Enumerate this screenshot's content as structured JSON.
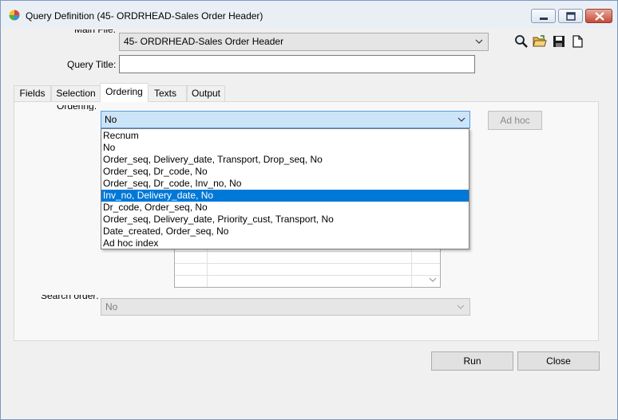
{
  "window": {
    "title": "Query Definition (45- ORDRHEAD-Sales Order Header)",
    "icon": "app-color-wheel-icon",
    "controls": [
      "minimize",
      "maximize",
      "close"
    ]
  },
  "main_file": {
    "label": "Main File:",
    "value": "45- ORDRHEAD-Sales Order Header"
  },
  "query_title": {
    "label": "Query Title:",
    "value": ""
  },
  "toolbar": {
    "icons": [
      "search-icon",
      "open-folder-icon",
      "save-icon",
      "new-document-icon"
    ]
  },
  "tabs": [
    {
      "label": "Fields",
      "active": false
    },
    {
      "label": "Selection",
      "active": false
    },
    {
      "label": "Ordering",
      "active": true
    },
    {
      "label": "Texts",
      "active": false
    },
    {
      "label": "Output",
      "active": false
    }
  ],
  "ordering": {
    "label": "Ordering:",
    "value": "No",
    "adhoc_button": "Ad hoc",
    "options": [
      "Recnum",
      "No",
      "Order_seq, Delivery_date, Transport, Drop_seq, No",
      "Order_seq, Dr_code, No",
      "Order_seq, Dr_code, Inv_no, No",
      "Inv_no, Delivery_date, No",
      "Dr_code, Order_seq, No",
      "Order_seq, Delivery_date, Priority_cust, Transport, No",
      "Date_created, Order_seq, No",
      "Ad hoc index"
    ],
    "highlighted_index": 5
  },
  "search_order": {
    "label": "Search order:",
    "value": "No"
  },
  "buttons": {
    "run": "Run",
    "close": "Close"
  },
  "colors": {
    "selection": "#0078d7",
    "combo_focus": "#cce4f7",
    "close_button": "#c74a38"
  }
}
